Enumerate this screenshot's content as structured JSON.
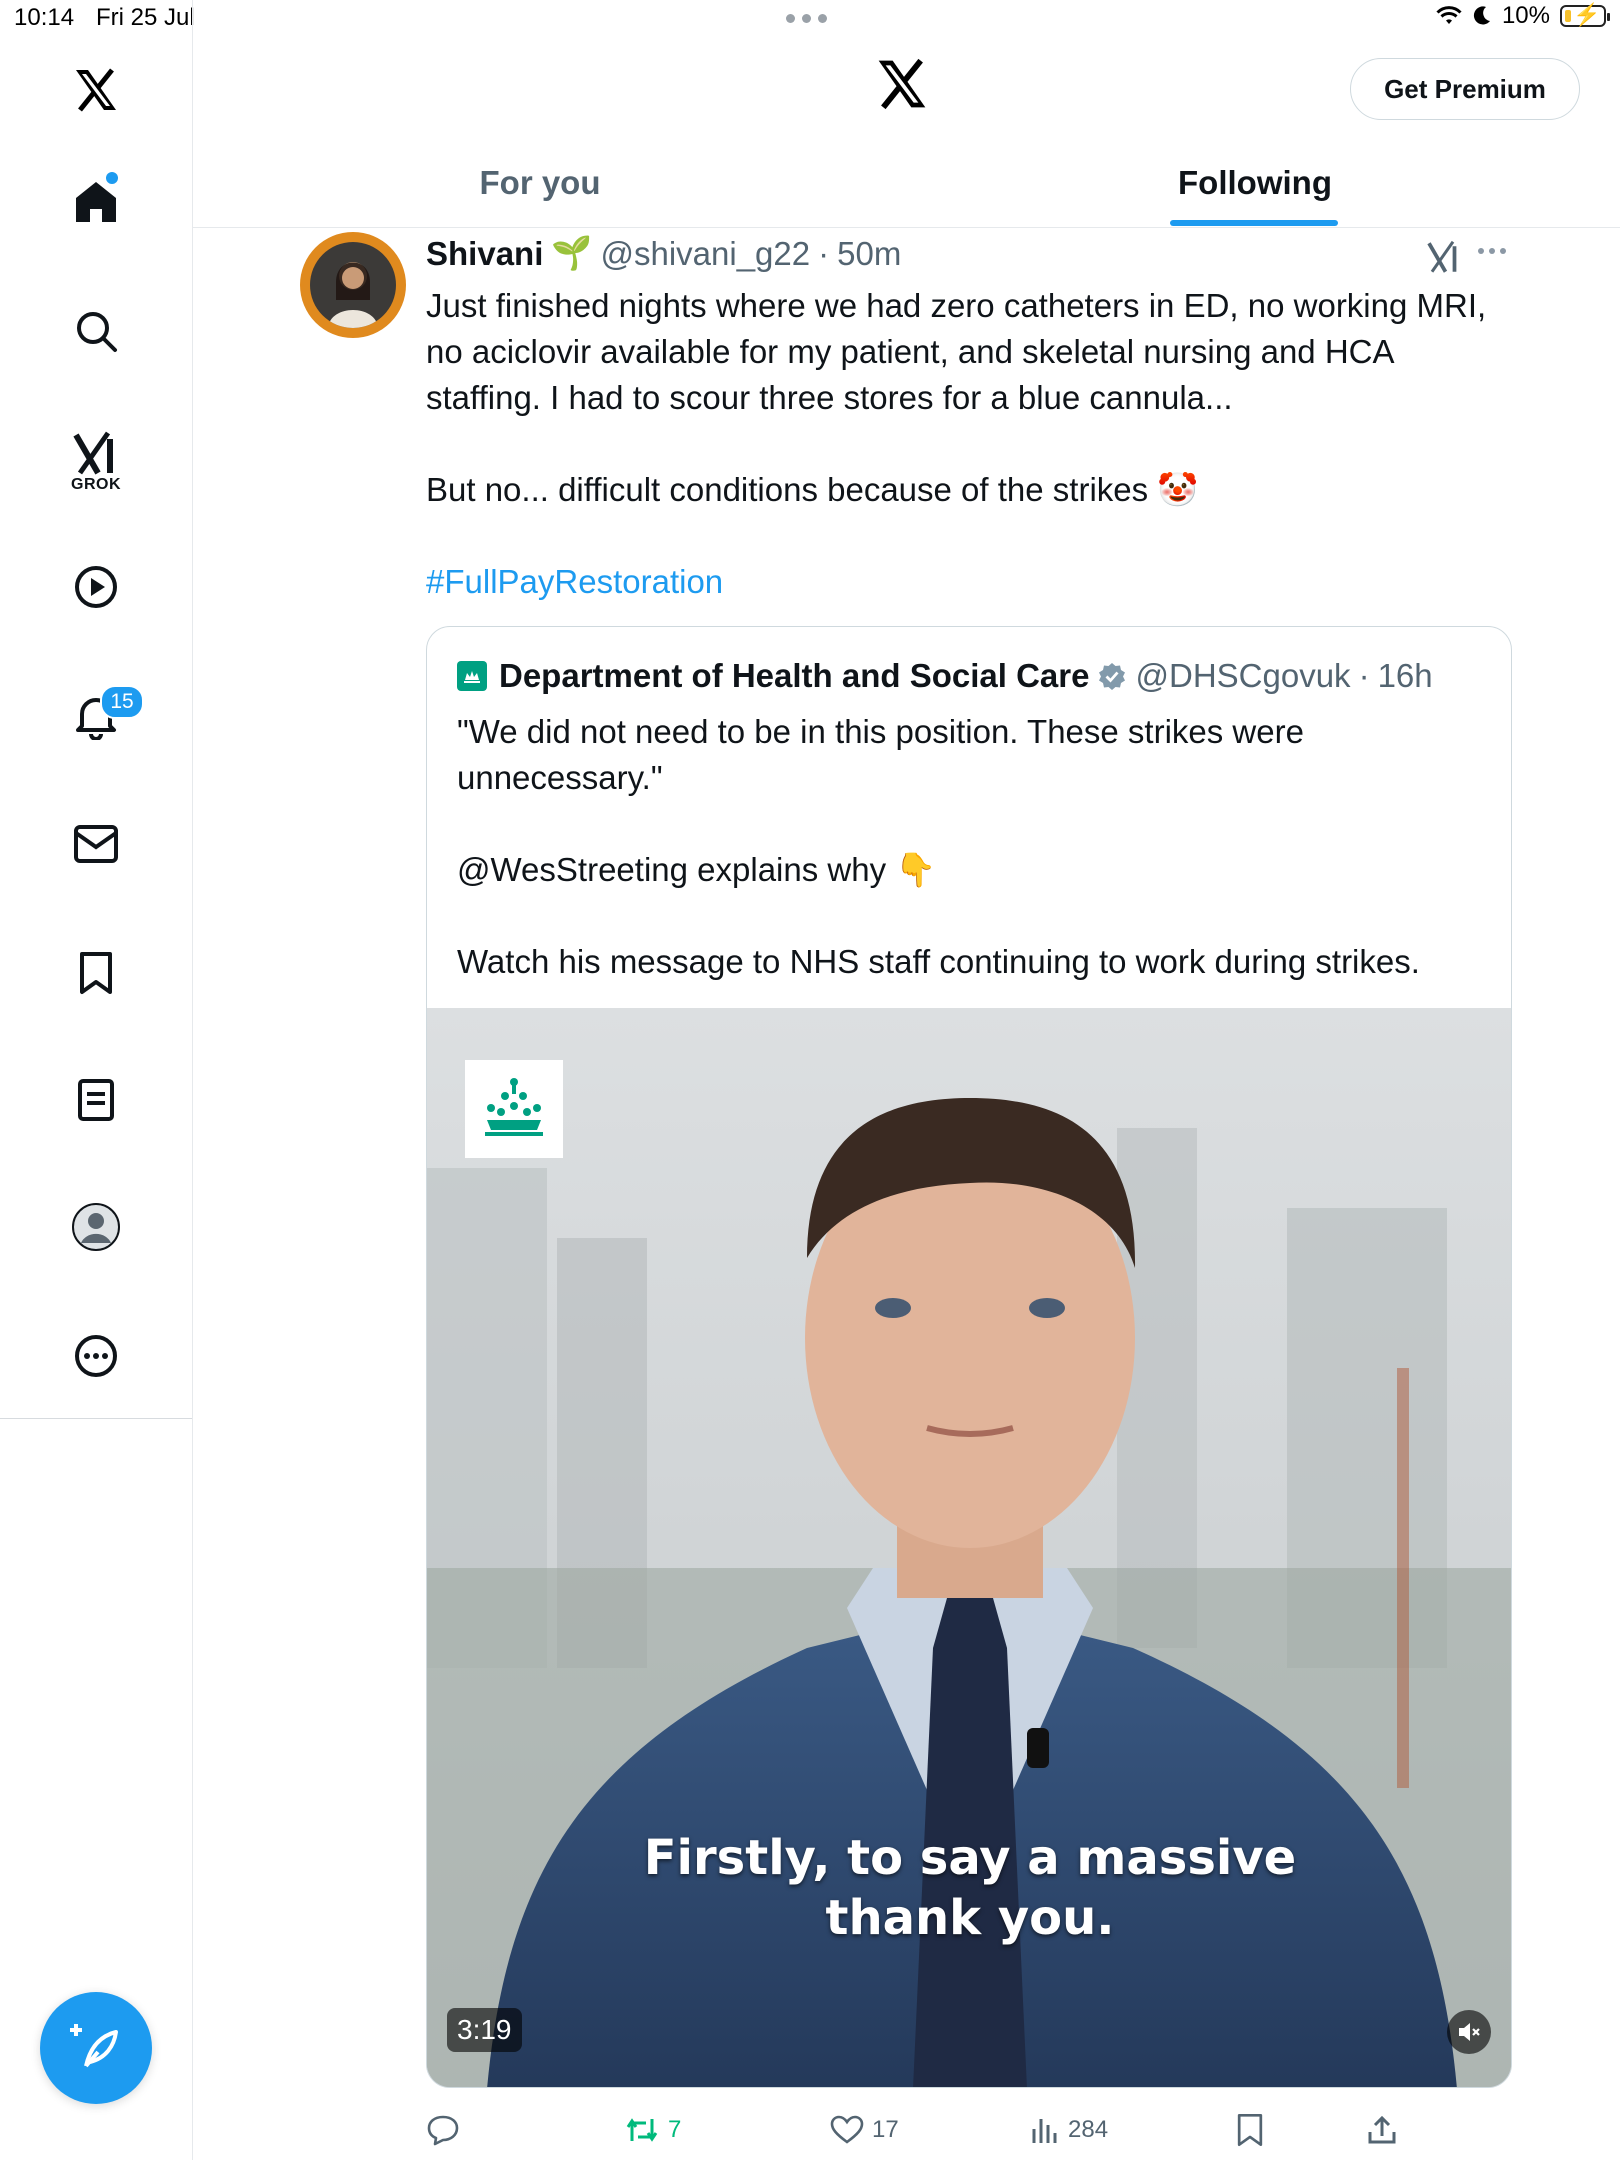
{
  "status_bar": {
    "time": "10:14",
    "date": "Fri 25 Jul",
    "battery": "10%"
  },
  "sidebar": {
    "items": [
      {
        "name": "home",
        "icon": "home-icon"
      },
      {
        "name": "explore",
        "icon": "search-icon"
      },
      {
        "name": "grok",
        "icon": "grok-icon",
        "label": "GROK"
      },
      {
        "name": "video",
        "icon": "play-icon"
      },
      {
        "name": "notifications",
        "icon": "bell-icon",
        "badge": "15"
      },
      {
        "name": "messages",
        "icon": "mail-icon"
      },
      {
        "name": "bookmarks",
        "icon": "bookmark-icon"
      },
      {
        "name": "lists",
        "icon": "list-icon"
      },
      {
        "name": "profile",
        "icon": "profile-icon"
      },
      {
        "name": "more",
        "icon": "more-circle-icon"
      }
    ]
  },
  "header": {
    "premium_label": "Get Premium",
    "tabs": [
      {
        "label": "For you",
        "active": false
      },
      {
        "label": "Following",
        "active": true
      }
    ]
  },
  "tweet": {
    "author_name": "Shivani",
    "author_emoji": "🌱",
    "handle": "@shivani_g22",
    "time": "50m",
    "text_lines": [
      "Just finished nights where we had zero catheters in ED, no working MRI,",
      "no aciclovir available for my patient, and skeletal nursing and HCA",
      "staffing. I had to scour three stores for a blue cannula..."
    ],
    "text_2": "But no... difficult conditions because of the strikes",
    "text_2_emoji": "🤡",
    "hashtag": "#FullPayRestoration",
    "quote": {
      "org_name": "Department of Health and Social Care",
      "handle": "@DHSCgovuk",
      "time": "16h",
      "line1": "\"We did not need to be in this position. These strikes were",
      "line2": "unnecessary.\"",
      "line3_mention": "@WesStreeting",
      "line3_rest": " explains why",
      "line3_emoji": "👇",
      "line4": "Watch his message to NHS staff continuing to work during strikes.",
      "video": {
        "subtitle_1": "Firstly, to say a massive",
        "subtitle_2": "thank you.",
        "duration": "3:19"
      }
    },
    "actions": {
      "reposts": "7",
      "likes": "17",
      "views": "284"
    }
  },
  "colors": {
    "accent": "#1d9bf0",
    "repost": "#00ba7c",
    "text_secondary": "#536471"
  }
}
